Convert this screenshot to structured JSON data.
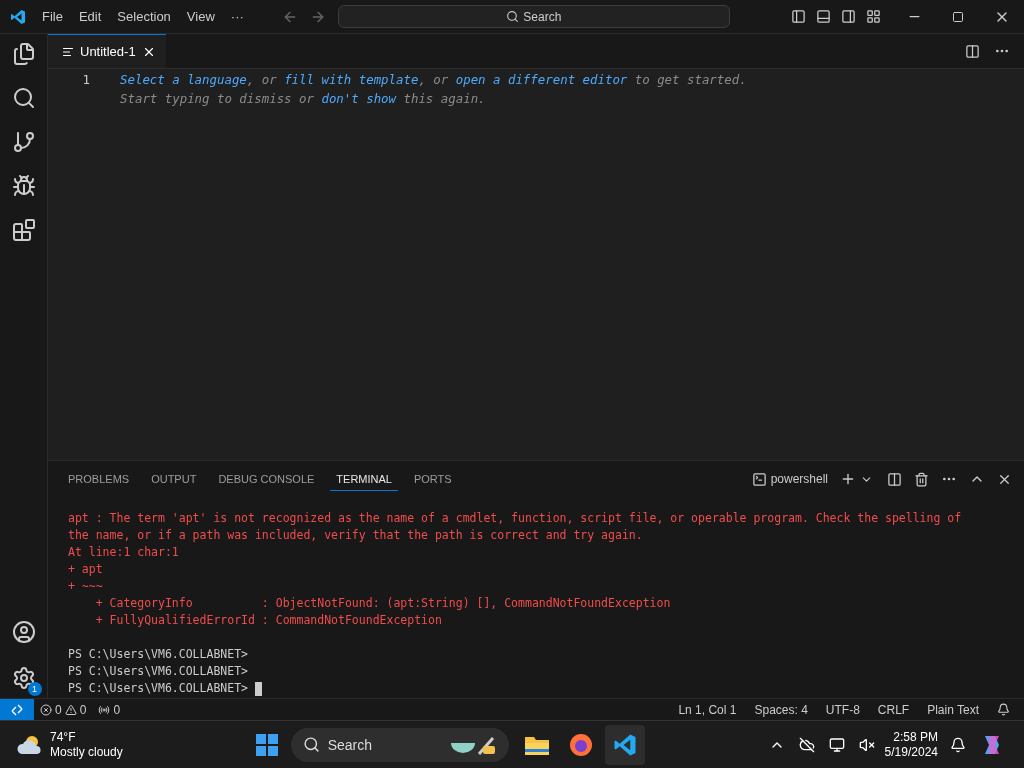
{
  "menu": [
    "File",
    "Edit",
    "Selection",
    "View",
    "···"
  ],
  "command_center": {
    "placeholder": "Search"
  },
  "editor_tabs": [
    {
      "label": "Untitled-1",
      "selected": true
    }
  ],
  "editor": {
    "line_number": "1",
    "hint_lines": [
      [
        {
          "text": "Select a language",
          "kind": "link"
        },
        {
          "text": ", or ",
          "kind": "plain"
        },
        {
          "text": "fill with template",
          "kind": "link"
        },
        {
          "text": ", or ",
          "kind": "plain"
        },
        {
          "text": "open a different editor",
          "kind": "link"
        },
        {
          "text": " to get started.",
          "kind": "plain"
        }
      ],
      [
        {
          "text": "Start typing to dismiss or ",
          "kind": "plain"
        },
        {
          "text": "don't show",
          "kind": "link"
        },
        {
          "text": " this again.",
          "kind": "plain"
        }
      ]
    ]
  },
  "panel_tabs": [
    {
      "label": "PROBLEMS",
      "selected": false
    },
    {
      "label": "OUTPUT",
      "selected": false
    },
    {
      "label": "DEBUG CONSOLE",
      "selected": false
    },
    {
      "label": "TERMINAL",
      "selected": true
    },
    {
      "label": "PORTS",
      "selected": false
    }
  ],
  "terminal": {
    "shell": "powershell",
    "error_lines": [
      {
        "text": "apt : The term 'apt' is not recognized as the name of a cmdlet, function, script file, or operable program. Check the spelling of",
        "kind": "error"
      },
      {
        "text": "the name, or if a path was included, verify that the path is correct and try again.",
        "kind": "error"
      },
      {
        "text": "At line:1 char:1",
        "kind": "error"
      },
      {
        "text": "+ apt",
        "kind": "error"
      },
      {
        "text": "+ ~~~",
        "kind": "error"
      },
      {
        "text": "    + CategoryInfo          : ObjectNotFound: (apt:String) [], CommandNotFoundException",
        "kind": "error"
      },
      {
        "text": "    + FullyQualifiedErrorId : CommandNotFoundException",
        "kind": "error"
      }
    ],
    "prompt_lines": [
      "PS C:\\Users\\VM6.COLLABNET>",
      "PS C:\\Users\\VM6.COLLABNET>",
      "PS C:\\Users\\VM6.COLLABNET>"
    ]
  },
  "settings_badge": "1",
  "status_bar": {
    "errors": "0",
    "warnings": "0",
    "ports": "0",
    "items": [
      "Ln 1, Col 1",
      "Spaces: 4",
      "UTF-8",
      "CRLF",
      "Plain Text"
    ]
  },
  "taskbar": {
    "temperature": "74°F",
    "weather": "Mostly cloudy",
    "search": "Search",
    "time": "2:58 PM",
    "date": "5/19/2024"
  }
}
